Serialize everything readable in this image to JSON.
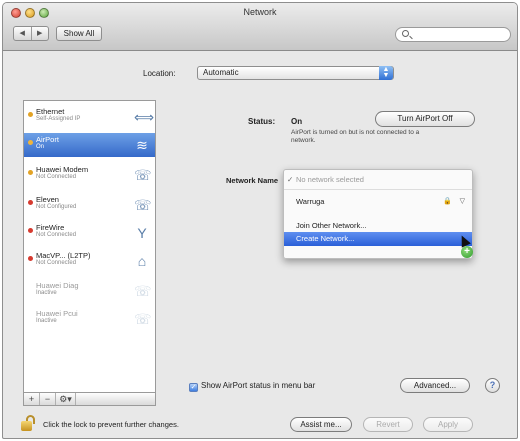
{
  "window": {
    "title": "Network"
  },
  "toolbar": {
    "back": "◀",
    "forward": "▶",
    "show_all": "Show All",
    "search_placeholder": ""
  },
  "location": {
    "label": "Location:",
    "value": "Automatic"
  },
  "services": [
    {
      "name": "Ethernet",
      "status": "Self-Assigned IP",
      "dot": "#e3a325",
      "icon": "ethernet-icon",
      "glyph": "⟺"
    },
    {
      "name": "AirPort",
      "status": "On",
      "dot": "#f0b43a",
      "icon": "wifi-icon",
      "glyph": "≋"
    },
    {
      "name": "Huawei Modem",
      "status": "Not Connected",
      "dot": "#e3a325",
      "icon": "phone-icon",
      "glyph": "☏"
    },
    {
      "name": "Eleven",
      "status": "Not Configured",
      "dot": "#d63a2f",
      "icon": "phone-icon",
      "glyph": "☏"
    },
    {
      "name": "FireWire",
      "status": "Not Connected",
      "dot": "#d63a2f",
      "icon": "firewire-icon",
      "glyph": "Y"
    },
    {
      "name": "MacVP... (L2TP)",
      "status": "Not Connected",
      "dot": "#d63a2f",
      "icon": "vpn-lock-icon",
      "glyph": "⌂"
    },
    {
      "name": "Huawei Diag",
      "status": "Inactive",
      "dot": "",
      "icon": "phone-icon",
      "glyph": "☏"
    },
    {
      "name": "Huawei Pcui",
      "status": "Inactive",
      "dot": "",
      "icon": "phone-icon",
      "glyph": "☏"
    }
  ],
  "sidebar_footer": {
    "add": "+",
    "remove": "−",
    "action": "⚙▾"
  },
  "detail": {
    "status_label": "Status:",
    "status_value": "On",
    "status_desc": "AirPort is turned on but is not connected to a network.",
    "airport_button": "Turn AirPort Off",
    "network_name_label": "Network Name"
  },
  "network_menu": {
    "none": "No network selected",
    "check": "✓",
    "network": "Warruga",
    "lock": "🔒",
    "signal": "▽",
    "join": "Join Other Network...",
    "create": "Create Network..."
  },
  "cursor_badge": "+",
  "show_status": {
    "checkmark": "✓",
    "label": "Show AirPort status in menu bar"
  },
  "advanced_button": "Advanced...",
  "help_button": "?",
  "lock_text": "Click the lock to prevent further changes.",
  "assist_button": "Assist me...",
  "revert_button": "Revert",
  "apply_button": "Apply"
}
